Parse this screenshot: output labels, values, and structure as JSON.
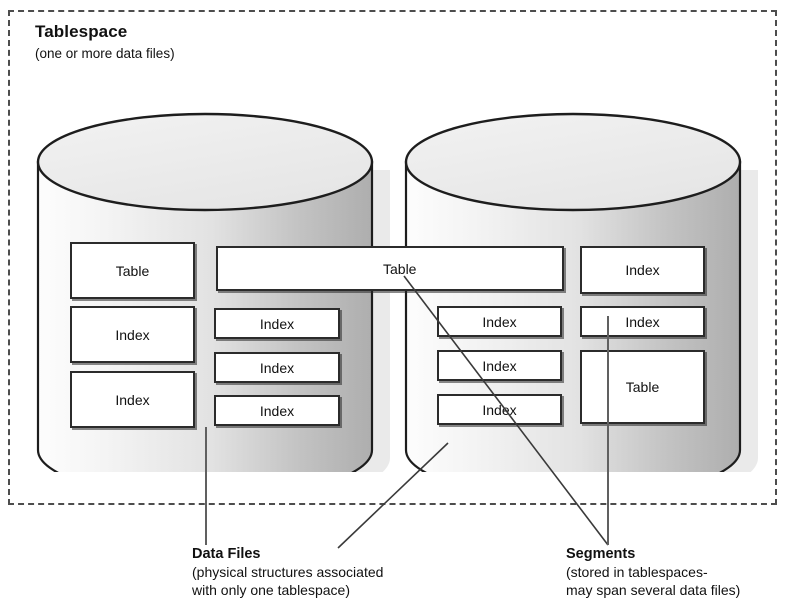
{
  "diagram": {
    "tablespace": {
      "title": "Tablespace",
      "subtitle": "(one or more data files)"
    },
    "cylinders": [
      {
        "name": "data-file-left"
      },
      {
        "name": "data-file-right"
      }
    ],
    "segments": {
      "left_column": [
        {
          "label": "Table"
        },
        {
          "label": "Index"
        },
        {
          "label": "Index"
        }
      ],
      "spanning": [
        {
          "label": "Table"
        }
      ],
      "middle_column": [
        {
          "label": "Index"
        },
        {
          "label": "Index"
        },
        {
          "label": "Index"
        }
      ],
      "inner_right_column": [
        {
          "label": "Index"
        },
        {
          "label": "Index"
        },
        {
          "label": "Index"
        }
      ],
      "right_column": [
        {
          "label": "Index"
        },
        {
          "label": "Index"
        },
        {
          "label": "Table"
        }
      ]
    },
    "captions": {
      "data_files": {
        "title": "Data Files",
        "line1": "(physical structures associated",
        "line2": "with only one tablespace)"
      },
      "segments": {
        "title": "Segments",
        "line1": "(stored in tablespaces-",
        "line2": "may span several data files)"
      }
    },
    "colors": {
      "outline": "#2b2b2b",
      "dashed_border": "#4d4d4d",
      "cylinder_top": "#ededed",
      "cylinder_body_light": "#fafafa",
      "cylinder_body_dark": "#b3b3b3",
      "box_fill": "#ffffff",
      "text": "#111111"
    }
  }
}
